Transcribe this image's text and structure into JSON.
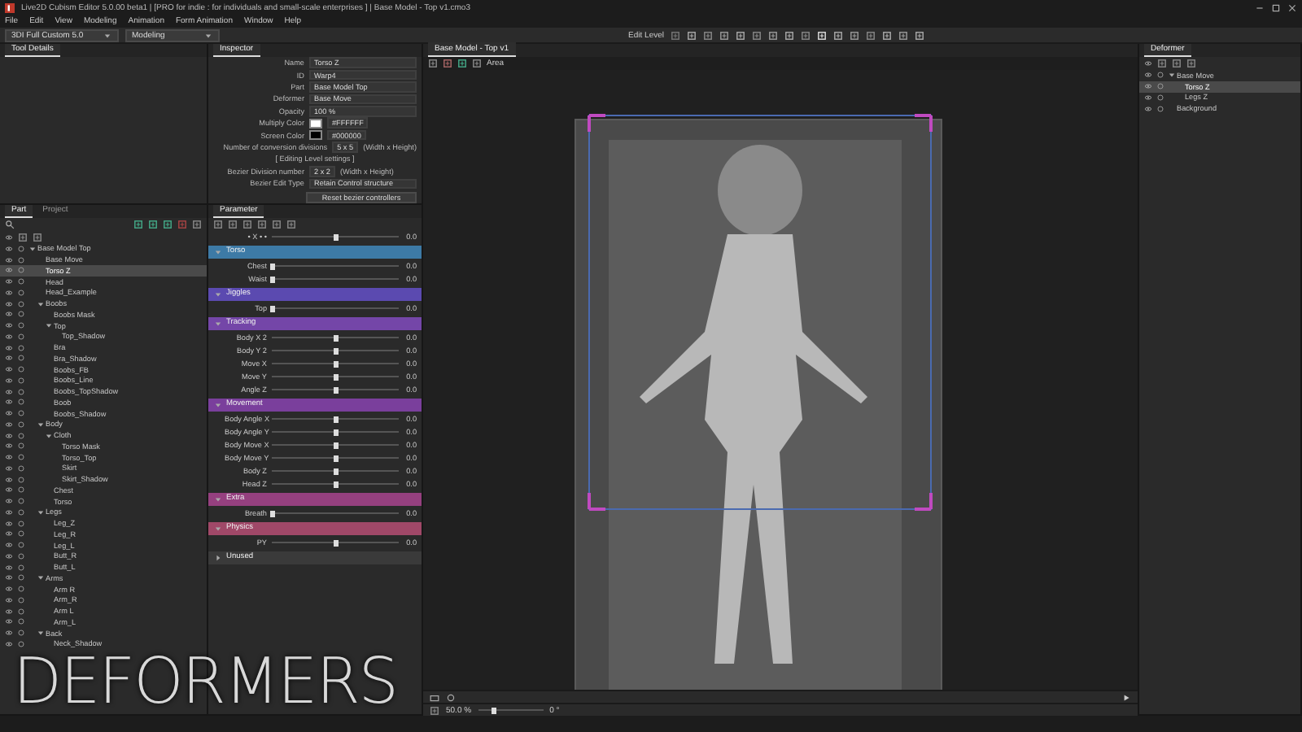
{
  "window": {
    "title": "Live2D Cubism Editor 5.0.00 beta1  |  [PRO for indie : for individuals and small-scale enterprises ]  |  Base Model - Top v1.cmo3"
  },
  "menu": [
    "File",
    "Edit",
    "View",
    "Modeling",
    "Animation",
    "Form Animation",
    "Window",
    "Help"
  ],
  "toolbar": {
    "workspace": "3DI Full Custom 5.0",
    "mode": "Modeling",
    "edit_level_label": "Edit Level"
  },
  "tool_details": {
    "tab": "Tool Details"
  },
  "inspector": {
    "tab": "Inspector",
    "fields": [
      {
        "kind": "field",
        "label": "Name",
        "value": "Torso Z"
      },
      {
        "kind": "field",
        "label": "ID",
        "value": "Warp4"
      },
      {
        "kind": "select",
        "label": "Part",
        "value": "Base Model Top"
      },
      {
        "kind": "select",
        "label": "Deformer",
        "value": "Base Move"
      },
      {
        "kind": "field",
        "label": "Opacity",
        "value": "100 %"
      },
      {
        "kind": "color",
        "label": "Multiply Color",
        "value": "#FFFFFF",
        "color": "#ffffff"
      },
      {
        "kind": "color",
        "label": "Screen Color",
        "value": "#000000",
        "color": "#000000"
      },
      {
        "kind": "divisions",
        "label": "Number of conversion divisions",
        "value": "5 x 5",
        "note": "(Width x Height)"
      },
      {
        "kind": "section",
        "label": "[ Editing Level settings ]"
      },
      {
        "kind": "divisions",
        "label": "Bezier Division number",
        "value": "2 x 2",
        "note": "(Width x Height)"
      },
      {
        "kind": "select",
        "label": "Bezier Edit Type",
        "value": "Retain Control structure"
      }
    ],
    "button": "Reset bezier controllers"
  },
  "parts_panel": {
    "tabs": [
      {
        "label": "Part",
        "selected": true
      },
      {
        "label": "Project",
        "selected": false
      }
    ],
    "tree": [
      {
        "label": "Base Model Top",
        "selected": false,
        "expanded": true,
        "children": [
          {
            "label": "Base Move",
            "selected": false
          },
          {
            "label": "Torso Z",
            "selected": true
          },
          {
            "label": "Head",
            "selected": false
          },
          {
            "label": "Head_Example",
            "selected": false
          },
          {
            "label": "Boobs",
            "selected": false,
            "expanded": true,
            "children": [
              {
                "label": "Boobs Mask",
                "selected": false
              },
              {
                "label": "Top",
                "selected": false,
                "expanded": true,
                "children": [
                  {
                    "label": "Top_Shadow",
                    "selected": false
                  }
                ]
              },
              {
                "label": "Bra",
                "selected": false
              },
              {
                "label": "Bra_Shadow",
                "selected": false
              },
              {
                "label": "Boobs_FB",
                "selected": false
              },
              {
                "label": "Boobs_Line",
                "selected": false
              },
              {
                "label": "Boobs_TopShadow",
                "selected": false
              },
              {
                "label": "Boob",
                "selected": false
              },
              {
                "label": "Boobs_Shadow",
                "selected": false
              }
            ]
          },
          {
            "label": "Body",
            "selected": false,
            "expanded": true,
            "children": [
              {
                "label": "Cloth",
                "selected": false,
                "expanded": true,
                "children": [
                  {
                    "label": "Torso Mask",
                    "selected": false
                  },
                  {
                    "label": "Torso_Top",
                    "selected": false
                  },
                  {
                    "label": "Skirt",
                    "selected": false
                  },
                  {
                    "label": "Skirt_Shadow",
                    "selected": false
                  }
                ]
              },
              {
                "label": "Chest",
                "selected": false
              },
              {
                "label": "Torso",
                "selected": false
              }
            ]
          },
          {
            "label": "Legs",
            "selected": false,
            "expanded": true,
            "children": [
              {
                "label": "Leg_Z",
                "selected": false
              },
              {
                "label": "Leg_R",
                "selected": false
              },
              {
                "label": "Leg_L",
                "selected": false
              },
              {
                "label": "Butt_R",
                "selected": false
              },
              {
                "label": "Butt_L",
                "selected": false
              }
            ]
          },
          {
            "label": "Arms",
            "selected": false,
            "expanded": true,
            "children": [
              {
                "label": "Arm R",
                "selected": false
              },
              {
                "label": "Arm_R",
                "selected": false
              },
              {
                "label": "Arm L",
                "selected": false
              },
              {
                "label": "Arm_L",
                "selected": false
              }
            ]
          },
          {
            "label": "Back",
            "selected": false,
            "expanded": true,
            "children": [
              {
                "label": "Neck_Shadow",
                "selected": false
              }
            ]
          }
        ]
      }
    ]
  },
  "parameter_panel": {
    "tab": "Parameter",
    "top_row": {
      "name": "• X • •",
      "level": 0.5,
      "reading": "0.0"
    },
    "groups": [
      {
        "name": "Torso",
        "color": "#3d7aa6",
        "expanded": true,
        "params": [
          {
            "name": "Chest",
            "level": 0,
            "reading": "0.0"
          },
          {
            "name": "Waist",
            "level": 0,
            "reading": "0.0"
          }
        ]
      },
      {
        "name": "Jiggles",
        "color": "#5b4ab0",
        "expanded": true,
        "params": [
          {
            "name": "Top",
            "level": 0,
            "reading": "0.0"
          }
        ]
      },
      {
        "name": "Tracking",
        "color": "#7446a8",
        "expanded": true,
        "params": [
          {
            "name": "Body X 2",
            "level": 0.5,
            "reading": "0.0"
          },
          {
            "name": "Body Y 2",
            "level": 0.5,
            "reading": "0.0"
          },
          {
            "name": "Move X",
            "level": 0.5,
            "reading": "0.0"
          },
          {
            "name": "Move Y",
            "level": 0.5,
            "reading": "0.0"
          },
          {
            "name": "Angle Z",
            "level": 0.5,
            "reading": "0.0"
          }
        ]
      },
      {
        "name": "Movement",
        "color": "#7a3f9c",
        "expanded": true,
        "params": [
          {
            "name": "Body Angle X",
            "level": 0.5,
            "reading": "0.0"
          },
          {
            "name": "Body Angle Y",
            "level": 0.5,
            "reading": "0.0"
          },
          {
            "name": "Body Move X",
            "level": 0.5,
            "reading": "0.0"
          },
          {
            "name": "Body Move Y",
            "level": 0.5,
            "reading": "0.0"
          },
          {
            "name": "Body Z",
            "level": 0.5,
            "reading": "0.0"
          },
          {
            "name": "Head Z",
            "level": 0.5,
            "reading": "0.0"
          }
        ]
      },
      {
        "name": "Extra",
        "color": "#95407f",
        "expanded": true,
        "params": [
          {
            "name": "Breath",
            "level": 0,
            "reading": "0.0"
          }
        ]
      },
      {
        "name": "Physics",
        "color": "#a04868",
        "expanded": true,
        "params": [
          {
            "name": "PY",
            "level": 0.5,
            "reading": "0.0"
          }
        ]
      },
      {
        "name": "Unused",
        "color": "#3a3a3a",
        "expanded": false
      }
    ]
  },
  "canvas": {
    "tab": "Base Model - Top v1",
    "tool_label": "Area",
    "zoom": "50.0 %",
    "zoom_slider": {
      "level": 0.25
    },
    "angle": "0 °"
  },
  "deformer_panel": {
    "tab": "Deformer",
    "tree": [
      {
        "label": "Base Move",
        "selected": false,
        "expanded": true,
        "children": [
          {
            "label": "Torso Z",
            "selected": true
          },
          {
            "label": "Legs Z",
            "selected": false
          }
        ]
      },
      {
        "label": "Background",
        "selected": false
      }
    ]
  },
  "caption": "DEFORMERS"
}
